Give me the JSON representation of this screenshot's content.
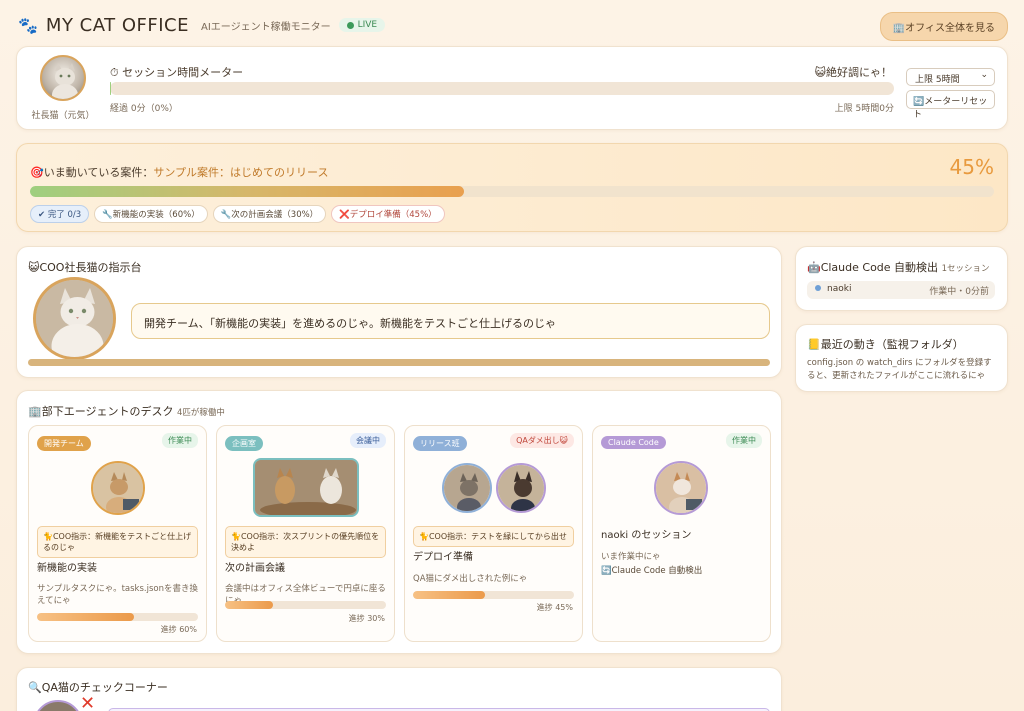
{
  "header": {
    "paw": "🐾",
    "title": "MY CAT OFFICE",
    "subtitle": "AIエージェント稼働モニター",
    "live": "LIVE",
    "office_button": "🏢オフィス全体を見る"
  },
  "session": {
    "ceo_label": "社長猫（元気）",
    "title": "⏱ セッション時間メーター",
    "status": "😺絶好調にゃ！",
    "elapsed": "経過 0分（0%）",
    "limit": "上限 5時間0分",
    "progress_percent": 0,
    "limit_select": "上限 5時間",
    "reset_button": "🔄メーターリセット"
  },
  "project": {
    "label": "🎯いま動いている案件：",
    "name": "サンプル案件：はじめてのリリース",
    "percent_label": "45%",
    "percent": 45,
    "chips": [
      {
        "label": "✔ 完了 0/3",
        "kind": "done"
      },
      {
        "label": "🔧新機能の実装（60%）",
        "kind": "normal"
      },
      {
        "label": "🔧次の計画会議（30%）",
        "kind": "normal"
      },
      {
        "label": "❌デプロイ準備（45%）",
        "kind": "bad"
      }
    ]
  },
  "coo": {
    "title": "😺COO社長猫の指示台",
    "message": "開発チーム、「新機能の実装」を進めるのじゃ。新機能をテストごと仕上げるのじゃ"
  },
  "claude": {
    "title": "🤖Claude Code 自動検出",
    "count": "1セッション",
    "session_name": "naoki",
    "session_status": "作業中・0分前"
  },
  "recent": {
    "title": "📒最近の動き（監視フォルダ）",
    "text": "config.json の watch_dirs にフォルダを登録すると、更新されたファイルがここに流れるにゃ"
  },
  "desks": {
    "title": "🏢部下エージェントのデスク",
    "count": "4匹が稼働中",
    "agents": [
      {
        "team": "開発チーム",
        "team_color": "#e0a24a",
        "state": "作業中",
        "instruction": "🐈COO指示：新機能をテストごと仕上げるのじゃ",
        "task": "新機能の実装",
        "desc": "サンプルタスクにゃ。tasks.jsonを書き換えてにゃ",
        "progress": 60,
        "progress_label": "進捗 60%"
      },
      {
        "team": "企画室",
        "team_color": "#7bbfbf",
        "state": "会議中",
        "instruction": "🐈COO指示：次スプリントの優先順位を決めよ",
        "task": "次の計画会議",
        "desc": "会議中はオフィス全体ビューで円卓に座るにゃ",
        "progress": 30,
        "progress_label": "進捗 30%"
      },
      {
        "team": "リリース班",
        "team_color": "#8fb0d8",
        "state": "QAダメ出し😺",
        "instruction": "🐈COO指示：テストを緑にしてから出せ",
        "task": "デプロイ準備",
        "desc": "QA猫にダメ出しされた例にゃ",
        "progress": 45,
        "progress_label": "進捗 45%"
      },
      {
        "team": "Claude Code",
        "team_color": "#b59ad6",
        "state": "作業中",
        "task": "naoki のセッション",
        "desc": "いま作業中にゃ",
        "source": "🔄Claude Code 自動検出"
      }
    ]
  },
  "qa": {
    "title": "🔍QA猫のチェックコーナー"
  }
}
